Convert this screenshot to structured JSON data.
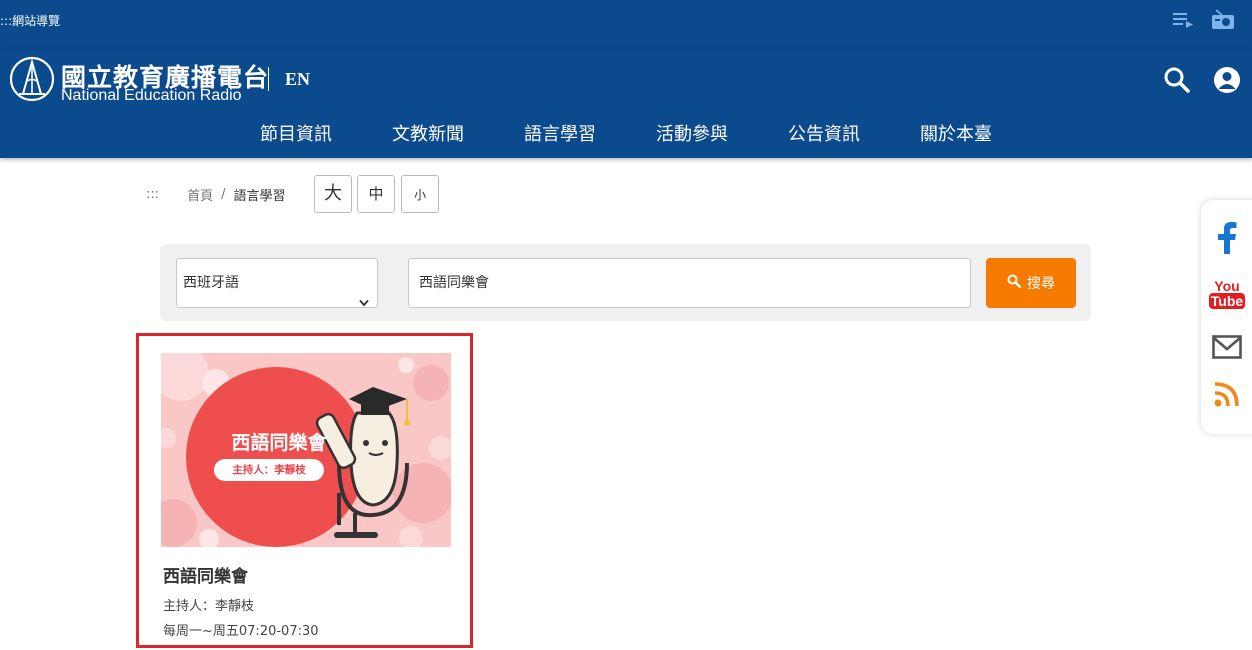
{
  "topbar": {
    "accesskey": ":::網站導覽"
  },
  "header": {
    "logo_zh": "國立教育廣播電台",
    "logo_en": "National Education Radio",
    "lang_link": "EN"
  },
  "nav": {
    "items": [
      {
        "label": "節目資訊"
      },
      {
        "label": "文教新聞"
      },
      {
        "label": "語言學習"
      },
      {
        "label": "活動參與"
      },
      {
        "label": "公告資訊"
      },
      {
        "label": "關於本臺"
      }
    ]
  },
  "breadcrumb": {
    "marker": ":::",
    "home": "首頁",
    "separator": "/",
    "current": "語言學習"
  },
  "font_size": {
    "large": "大",
    "medium": "中",
    "small": "小"
  },
  "search": {
    "language_selected": "西班牙語",
    "keyword": "西語同樂會",
    "button_label": "搜尋"
  },
  "program": {
    "thumb_title": "西語同樂會",
    "thumb_host": "主持人：李靜枝",
    "title": "西語同樂會",
    "host": "主持人：李靜枝",
    "schedule": "每周一~周五07:20-07:30"
  },
  "colors": {
    "brand_blue": "#0b4a8c",
    "accent_orange": "#f77b00",
    "highlight_red": "#d8262e"
  },
  "social": {
    "icons": [
      "facebook-icon",
      "youtube-icon",
      "mail-icon",
      "rss-icon"
    ],
    "youtube_top": "You",
    "youtube_bottom": "Tube"
  }
}
